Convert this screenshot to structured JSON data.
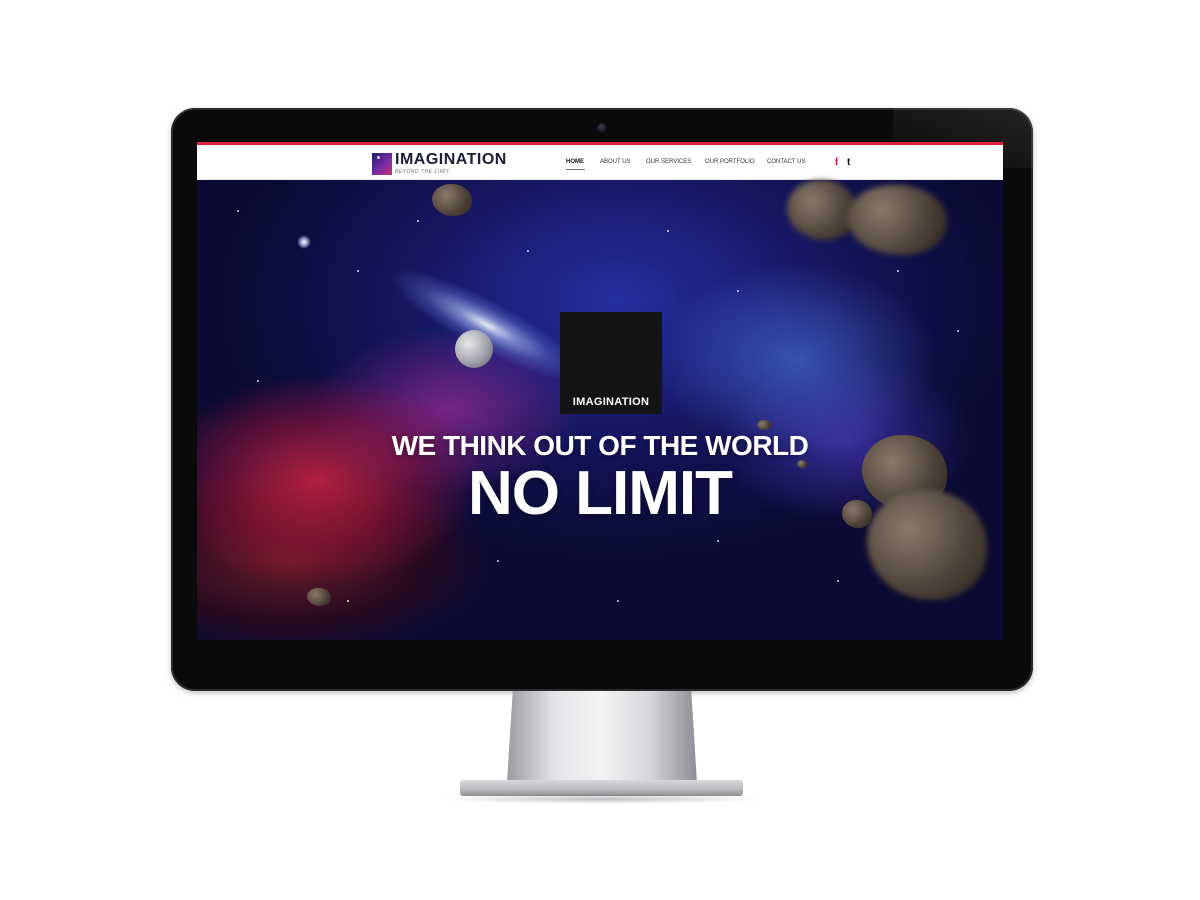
{
  "brand": {
    "name": "IMAGINATION",
    "tagline": "BEYOND THE LIMIT"
  },
  "nav": {
    "items": [
      {
        "label": "HOME",
        "active": true
      },
      {
        "label": "ABOUT US",
        "active": false
      },
      {
        "label": "OUR SERVICES",
        "active": false
      },
      {
        "label": "OUR PORTFOLIO",
        "active": false
      },
      {
        "label": "CONTACT US",
        "active": false
      }
    ]
  },
  "social": {
    "facebook": "f",
    "twitter": "t",
    "icons": [
      "facebook-icon",
      "twitter-icon"
    ]
  },
  "hero": {
    "logo_text": "IMAGINATION",
    "headline": "WE THINK OUT OF THE WORLD",
    "subheadline": "NO LIMIT"
  },
  "colors": {
    "accent": "#e2213a",
    "header_bg": "#ffffff",
    "hero_text": "#ffffff"
  }
}
